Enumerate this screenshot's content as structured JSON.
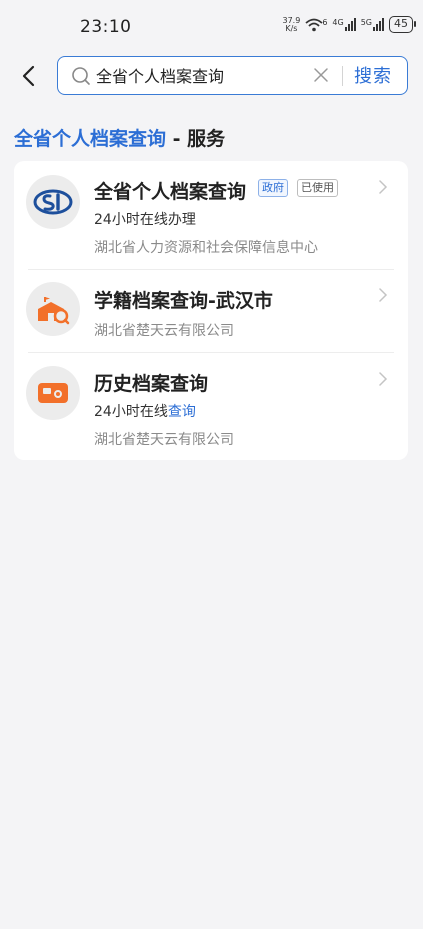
{
  "status_bar": {
    "time": "23:10",
    "net_speed_value": "37.9",
    "net_speed_unit": "K/s",
    "wifi_badge": "6",
    "sim1_label": "4G",
    "sim2_label": "5G",
    "battery": "45"
  },
  "search": {
    "value": "全省个人档案查询",
    "button_label": "搜索"
  },
  "section": {
    "title_accent": "全省个人档案查询",
    "title_separator": " - ",
    "title_rest": "服务"
  },
  "results": [
    {
      "title": "全省个人档案查询",
      "tags": [
        "政府",
        "已使用"
      ],
      "subtitle": "24小时在线办理",
      "org": "湖北省人力资源和社会保障信息中心"
    },
    {
      "title": "学籍档案查询-武汉市",
      "org": "湖北省楚天云有限公司"
    },
    {
      "title": "历史档案查询",
      "subtitle_prefix": "24小时在线",
      "subtitle_link": "查询",
      "org": "湖北省楚天云有限公司"
    }
  ],
  "colors": {
    "accent": "#2c6ed5",
    "icon_orange": "#f2702a",
    "logo_blue": "#1d4f9c"
  }
}
